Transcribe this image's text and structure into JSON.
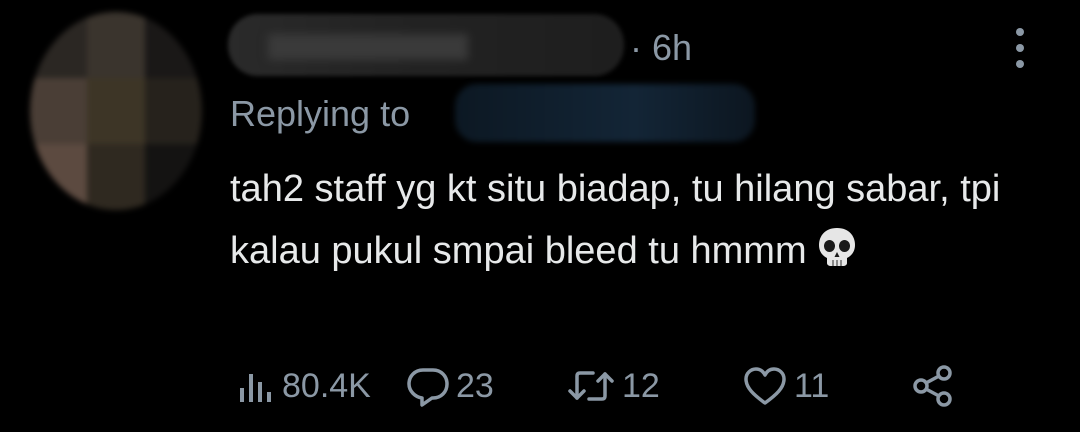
{
  "tweet": {
    "timestamp": "· 6h",
    "replying_label": "Replying to",
    "text": "tah2 staff yg kt situ biadap, tu hilang sabar, tpi kalau pukul smpai bleed tu hmmm",
    "emoji": "skull-emoji"
  },
  "actions": {
    "views": {
      "icon": "views-icon",
      "count": "80.4K"
    },
    "replies": {
      "icon": "reply-icon",
      "count": "23"
    },
    "retweets": {
      "icon": "retweet-icon",
      "count": "12"
    },
    "likes": {
      "icon": "heart-icon",
      "count": "11"
    },
    "share": {
      "icon": "share-icon"
    }
  },
  "colors": {
    "background": "#000000",
    "text": "#e7e9ea",
    "muted": "#8b98a5"
  }
}
